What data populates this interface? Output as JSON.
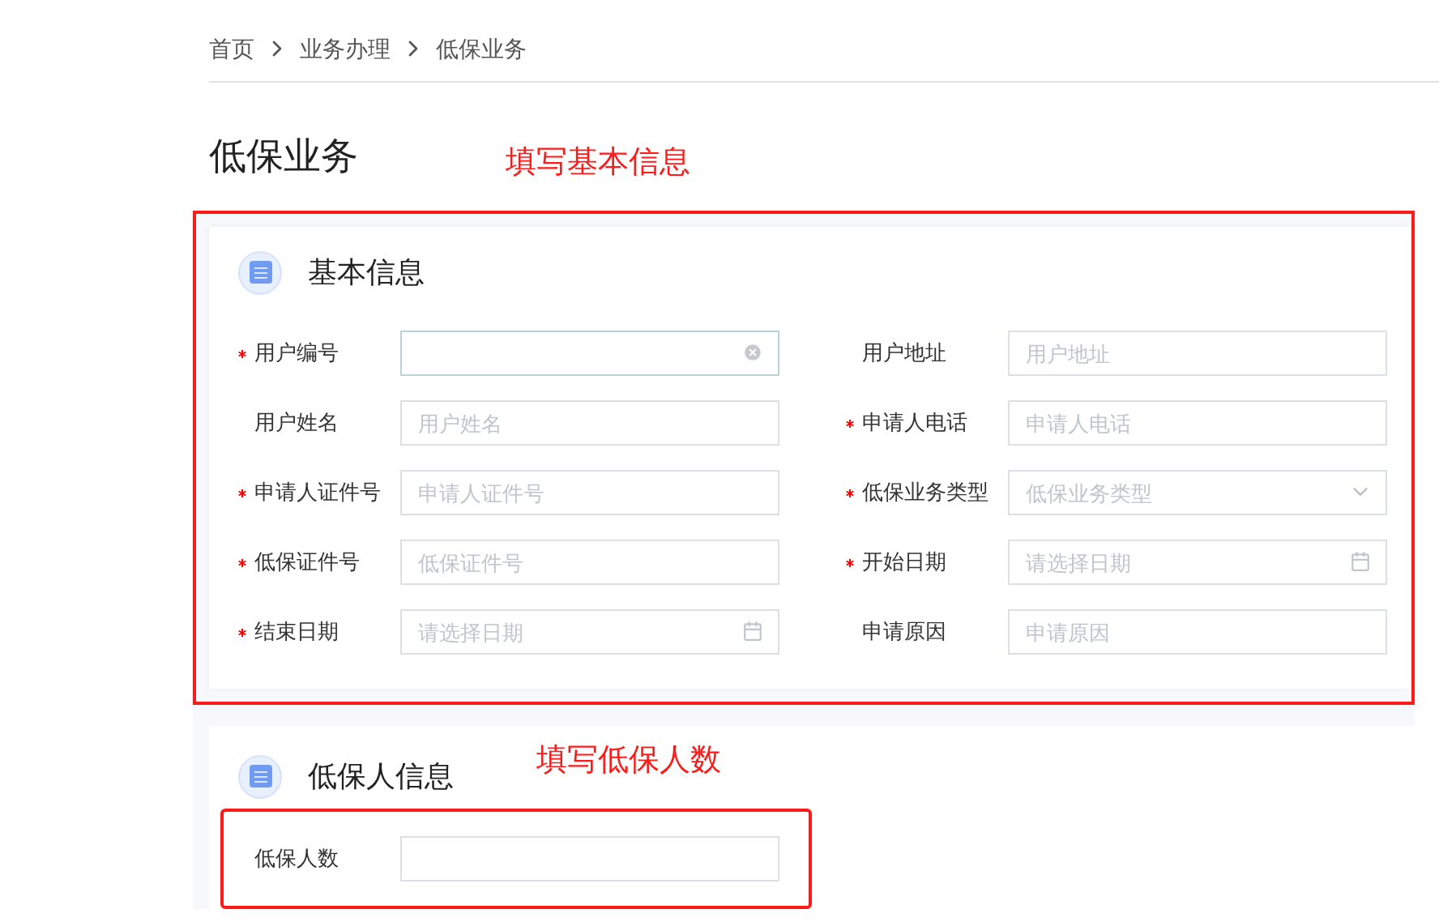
{
  "breadcrumb": [
    {
      "label": "首页"
    },
    {
      "label": "业务办理"
    },
    {
      "label": "低保业务"
    }
  ],
  "page_title": "低保业务",
  "sections": [
    {
      "title": "基本信息",
      "annotation": {
        "text": "填写基本信息",
        "kind": "card"
      },
      "fields": [
        {
          "label": "用户编号",
          "required": true,
          "kind": "text",
          "focused": true
        },
        {
          "label": "用户地址",
          "required": false,
          "kind": "text",
          "focused": false,
          "placeholder": "用户地址"
        },
        {
          "label": "用户姓名",
          "required": false,
          "kind": "text",
          "focused": false,
          "placeholder": "用户姓名"
        },
        {
          "label": "申请人电话",
          "required": true,
          "kind": "text",
          "focused": false,
          "placeholder": "申请人电话"
        },
        {
          "label": "申请人证件号",
          "required": true,
          "kind": "text",
          "focused": false,
          "placeholder": "申请人证件号"
        },
        {
          "label": "低保业务类型",
          "required": true,
          "kind": "select",
          "focused": false,
          "placeholder": "低保业务类型"
        },
        {
          "label": "低保证件号",
          "required": true,
          "kind": "text",
          "focused": false,
          "placeholder": "低保证件号"
        },
        {
          "label": "开始日期",
          "required": true,
          "kind": "date",
          "focused": false,
          "placeholder": "请选择日期"
        },
        {
          "label": "结束日期",
          "required": true,
          "kind": "date",
          "focused": false,
          "placeholder": "请选择日期"
        },
        {
          "label": "申请原因",
          "required": false,
          "kind": "text",
          "focused": false,
          "placeholder": "申请原因"
        }
      ]
    },
    {
      "title": "低保人信息",
      "annotation": {
        "text": "填写低保人数",
        "kind": "fields"
      },
      "fields": [
        {
          "label": "低保人数",
          "required": false,
          "kind": "text",
          "focused": false
        }
      ]
    }
  ]
}
